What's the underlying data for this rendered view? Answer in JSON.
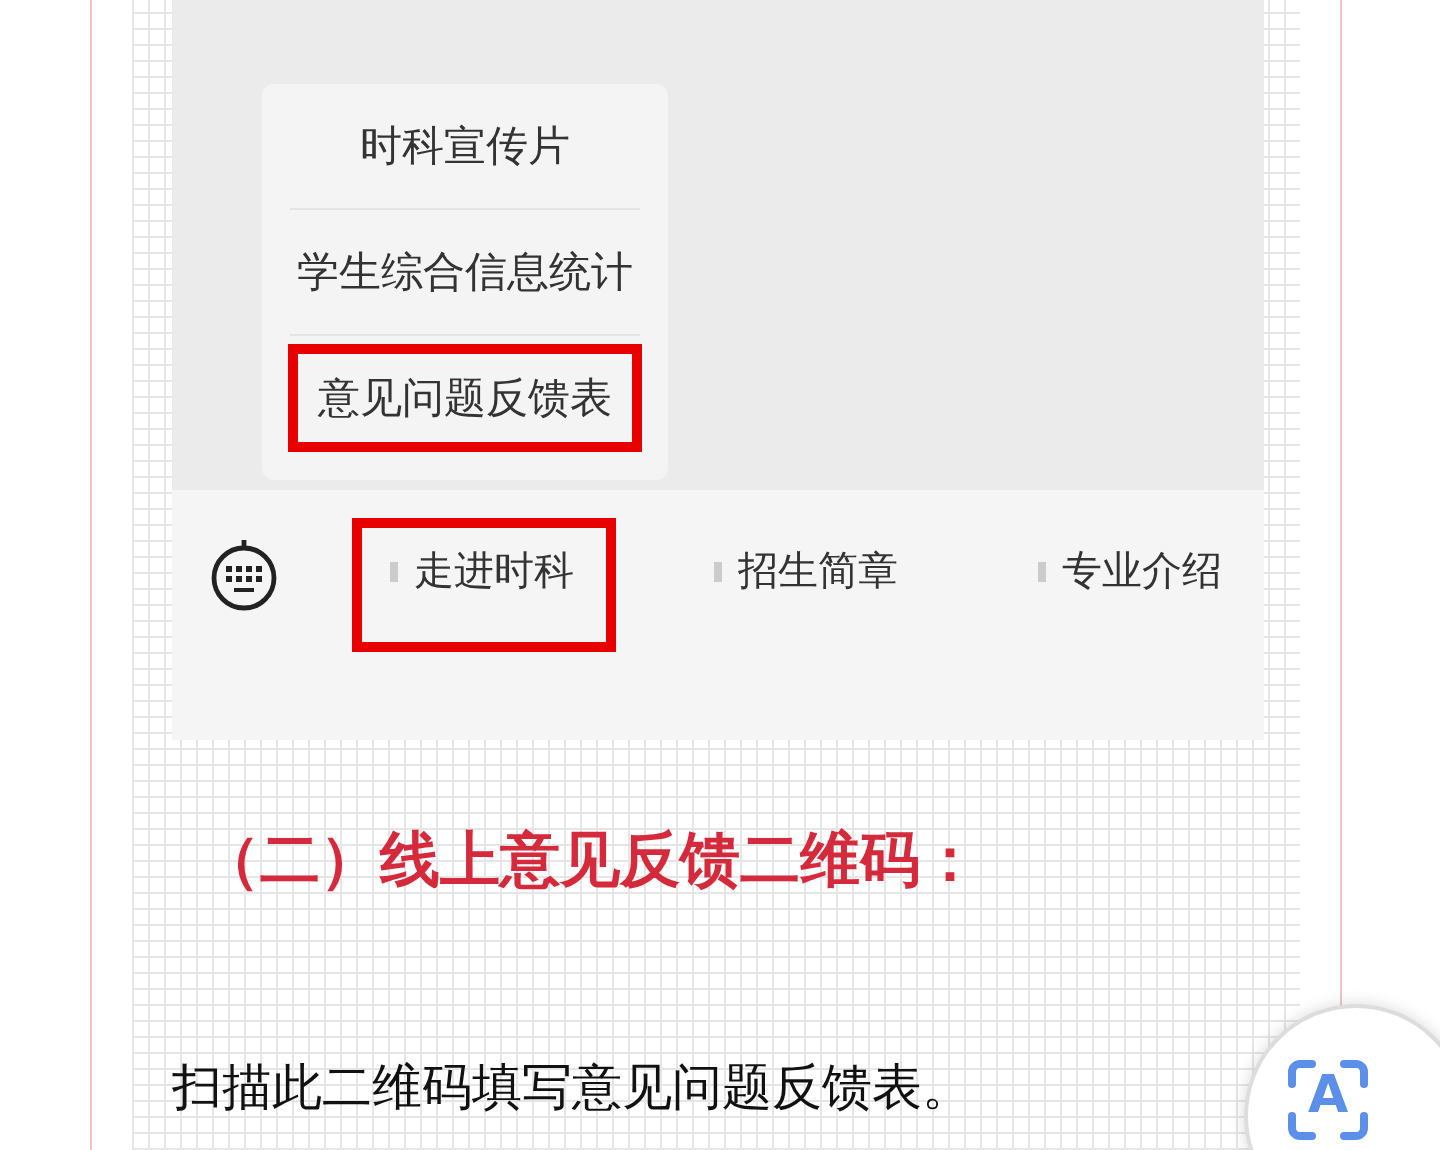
{
  "embedded_screenshot": {
    "menu": [
      {
        "label": "时科宣传片",
        "highlighted": false
      },
      {
        "label": "学生综合信息统计",
        "highlighted": false
      },
      {
        "label": "意见问题反馈表",
        "highlighted": true
      }
    ],
    "bottom_bar": [
      {
        "label": "走进时科",
        "highlighted": true
      },
      {
        "label": "招生简章",
        "highlighted": false
      },
      {
        "label": "专业介绍",
        "highlighted": false
      }
    ]
  },
  "heading": "（二）线上意见反馈二维码：",
  "paragraph": "扫描此二维码填写意见问题反馈表。",
  "text_scan_button": {
    "glyph": "A"
  }
}
